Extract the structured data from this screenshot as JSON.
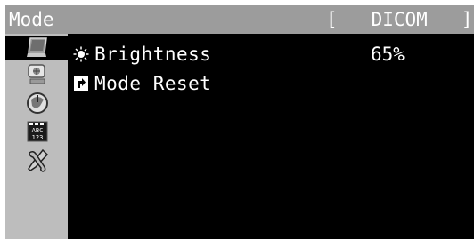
{
  "header": {
    "title": "Mode",
    "mode_left_bracket": "[",
    "mode_name": "DICOM",
    "mode_right_bracket": "]"
  },
  "sidebar": {
    "items": [
      {
        "icon": "monitor-color-icon",
        "selected": true
      },
      {
        "icon": "monitor-screen-icon",
        "selected": false
      },
      {
        "icon": "power-globe-icon",
        "selected": false
      },
      {
        "icon": "language-abc-icon",
        "label": "ABC 123",
        "selected": false
      },
      {
        "icon": "tools-wrench-icon",
        "selected": false
      }
    ]
  },
  "menu": {
    "items": [
      {
        "label": "Brightness",
        "value": "65%",
        "icon": "brightness-sun-icon"
      },
      {
        "label": "Mode Reset",
        "value": "",
        "icon": "reset-arrow-icon"
      }
    ]
  },
  "colors": {
    "titlebar": "#9c9c9c",
    "sidebar": "#bdbdbd",
    "panel": "#000000",
    "text": "#ffffff"
  }
}
